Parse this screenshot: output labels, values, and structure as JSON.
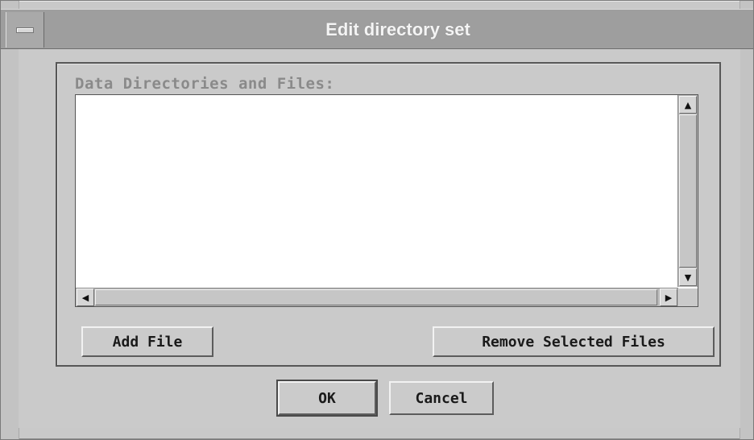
{
  "window": {
    "title": "Edit directory set",
    "menu_icon": "window-menu-icon"
  },
  "group": {
    "label": "Data Directories and Files:"
  },
  "listbox": {
    "items": []
  },
  "scrollbars": {
    "up_arrow": "▲",
    "down_arrow": "▼",
    "left_arrow": "◀",
    "right_arrow": "▶"
  },
  "buttons": {
    "add_file": "Add File",
    "remove_selected": "Remove Selected Files",
    "ok": "OK",
    "cancel": "Cancel"
  },
  "colors": {
    "titlebar": "#9e9e9e",
    "window_bg": "#cacaca",
    "list_bg": "#ffffff",
    "label": "#8a8a8a"
  }
}
